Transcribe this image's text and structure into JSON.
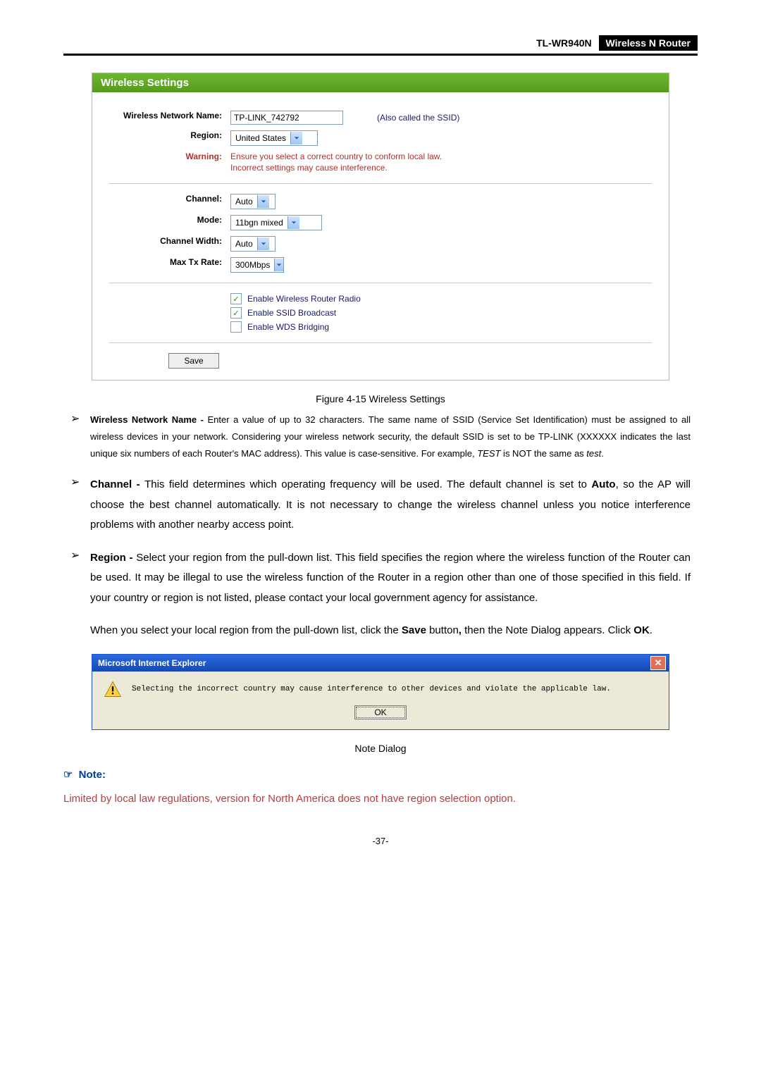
{
  "header": {
    "model": "TL-WR940N",
    "title": "Wireless  N  Router"
  },
  "panel": {
    "title": "Wireless Settings",
    "labels": {
      "network_name": "Wireless Network Name:",
      "region": "Region:",
      "warning": "Warning:",
      "channel": "Channel:",
      "mode": "Mode:",
      "channel_width": "Channel Width:",
      "max_tx": "Max Tx Rate:"
    },
    "values": {
      "network_name": "TP-LINK_742792",
      "ssid_aside": "(Also called the SSID)",
      "region": "United States",
      "warning1": "Ensure you select a correct country to conform local law.",
      "warning2": "Incorrect settings may cause interference.",
      "channel": "Auto",
      "mode": "11bgn mixed",
      "channel_width": "Auto",
      "max_tx": "300Mbps"
    },
    "checkboxes": {
      "radio": "Enable Wireless Router Radio",
      "ssid": "Enable SSID Broadcast",
      "wds": "Enable WDS Bridging"
    },
    "save": "Save"
  },
  "figure_caption": "Figure 4-15   Wireless Settings",
  "bullets": {
    "b1_bold": "Wireless Network Name - ",
    "b1_text": "Enter a value of up to 32 characters. The same name of SSID (Service Set Identification) must be assigned to all wireless devices in your network. Considering your wireless network security, the default SSID is set to be TP-LINK (XXXXXX indicates the last unique six numbers of each Router's MAC address). This value is case-sensitive. For example, ",
    "b1_i1": "TEST",
    "b1_mid": " is NOT the same as ",
    "b1_i2": "test",
    "b1_end": ".",
    "b2_bold": "Channel - ",
    "b2_text": "This field determines which operating frequency will be used. The default channel is set to ",
    "b2_bold2": "Auto",
    "b2_text2": ", so the AP will choose the best channel automatically. It is not necessary to change the wireless channel unless you notice interference problems with another nearby access point.",
    "b3_bold": "Region - ",
    "b3_text": "Select your region from the pull-down list. This field specifies the region where the wireless function of the Router can be used. It may be illegal to use the wireless function of the Router in a region other than one of those specified in this field. If your country or region is not listed, please contact your local government agency for assistance."
  },
  "extra": {
    "p1a": "When you select your local region from the pull-down list, click the ",
    "p1b": "Save",
    "p1c": " button",
    "p1d": ",",
    "p1e": " then the Note Dialog appears. Click ",
    "p1f": "OK",
    "p1g": "."
  },
  "dialog": {
    "title": "Microsoft Internet Explorer",
    "msg": "Selecting the incorrect country may cause interference to other devices and violate the applicable law.",
    "ok": "OK"
  },
  "dialog_caption": "Note Dialog",
  "note_label": "Note:",
  "note_body": "Limited by local law regulations, version for North America does not have region selection option.",
  "page_num": "-37-"
}
